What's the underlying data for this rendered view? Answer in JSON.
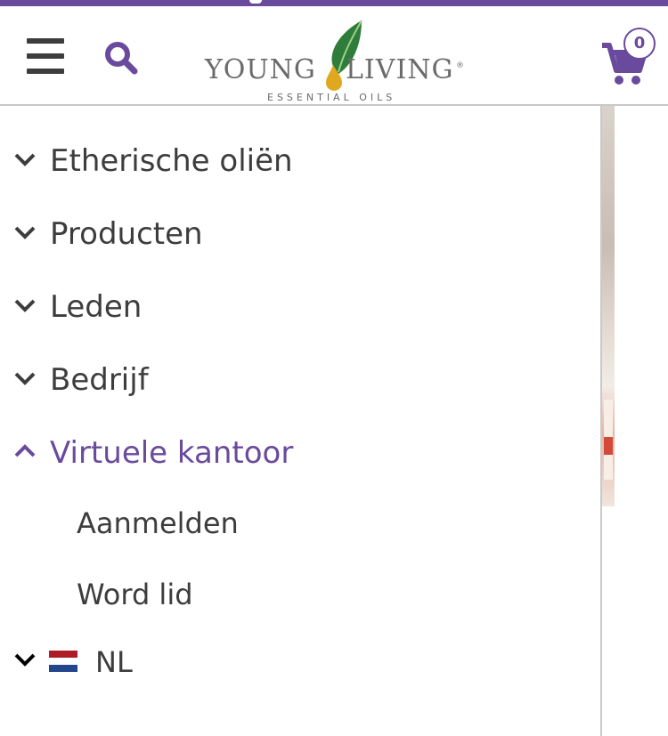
{
  "colors": {
    "brand_purple": "#6a4a9c",
    "text_dark": "#3d3d3d",
    "logo_gray": "#6b6b6b",
    "leaf_green": "#2f7d3a",
    "drop_gold": "#e0a81f"
  },
  "header": {
    "menu_icon": "hamburger-icon",
    "search_icon": "search-icon",
    "logo": {
      "word1": "YOUNG",
      "word2": "LIVING",
      "registered": "®",
      "tagline": "ESSENTIAL OILS"
    },
    "cart": {
      "icon": "cart-icon",
      "count": "0"
    }
  },
  "nav": {
    "items": [
      {
        "label": "Etherische oliën",
        "expanded": false,
        "icon": "chevron-down-icon"
      },
      {
        "label": "Producten",
        "expanded": false,
        "icon": "chevron-down-icon"
      },
      {
        "label": "Leden",
        "expanded": false,
        "icon": "chevron-down-icon"
      },
      {
        "label": "Bedrijf",
        "expanded": false,
        "icon": "chevron-down-icon"
      },
      {
        "label": "Virtuele kantoor",
        "expanded": true,
        "icon": "chevron-up-icon",
        "children": [
          {
            "label": "Aanmelden"
          },
          {
            "label": "Word lid"
          }
        ]
      }
    ],
    "language": {
      "label": "NL",
      "flag": "netherlands-flag-icon",
      "icon": "chevron-down-icon"
    }
  }
}
